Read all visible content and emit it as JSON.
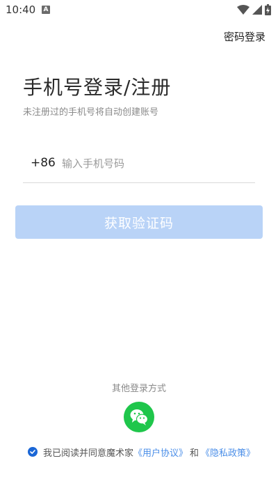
{
  "status_bar": {
    "time": "10:40",
    "a_label": "A"
  },
  "header": {
    "password_login_label": "密码登录"
  },
  "main": {
    "title": "手机号登录/注册",
    "subtitle": "未注册过的手机号将自动创建账号",
    "country_code": "+86",
    "phone_placeholder": "输入手机号码",
    "get_code_label": "获取验证码"
  },
  "footer": {
    "other_login_label": "其他登录方式",
    "wechat_icon": "wechat-icon",
    "agreement_prefix": "我已阅读并同意魔术家",
    "user_agreement": "《用户协议》",
    "and_text": "和",
    "privacy_policy": "《隐私政策》",
    "agreement_checked": true
  },
  "colors": {
    "primary_disabled": "#b9d3f7",
    "link": "#4a8ee8",
    "checkbox": "#1a66d6",
    "wechat": "#1fc64b"
  }
}
